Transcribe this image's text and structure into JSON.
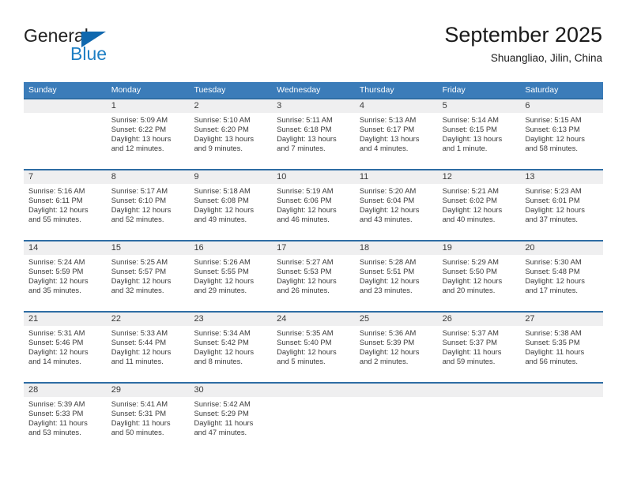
{
  "brand": {
    "name_part1": "General",
    "name_part2": "Blue",
    "accent_color": "#1068ae",
    "logo_icon": "triangle-flag-icon"
  },
  "header": {
    "title": "September 2025",
    "subtitle": "Shuangliao, Jilin, China"
  },
  "calendar": {
    "header_bg": "#3b7cb9",
    "row_border": "#2e6da4",
    "daynum_bg": "#efeff0",
    "weekdays": [
      "Sunday",
      "Monday",
      "Tuesday",
      "Wednesday",
      "Thursday",
      "Friday",
      "Saturday"
    ],
    "weeks": [
      [
        {
          "day": "",
          "sunrise": "",
          "sunset": "",
          "daylight_line1": "",
          "daylight_line2": ""
        },
        {
          "day": "1",
          "sunrise": "Sunrise: 5:09 AM",
          "sunset": "Sunset: 6:22 PM",
          "daylight_line1": "Daylight: 13 hours",
          "daylight_line2": "and 12 minutes."
        },
        {
          "day": "2",
          "sunrise": "Sunrise: 5:10 AM",
          "sunset": "Sunset: 6:20 PM",
          "daylight_line1": "Daylight: 13 hours",
          "daylight_line2": "and 9 minutes."
        },
        {
          "day": "3",
          "sunrise": "Sunrise: 5:11 AM",
          "sunset": "Sunset: 6:18 PM",
          "daylight_line1": "Daylight: 13 hours",
          "daylight_line2": "and 7 minutes."
        },
        {
          "day": "4",
          "sunrise": "Sunrise: 5:13 AM",
          "sunset": "Sunset: 6:17 PM",
          "daylight_line1": "Daylight: 13 hours",
          "daylight_line2": "and 4 minutes."
        },
        {
          "day": "5",
          "sunrise": "Sunrise: 5:14 AM",
          "sunset": "Sunset: 6:15 PM",
          "daylight_line1": "Daylight: 13 hours",
          "daylight_line2": "and 1 minute."
        },
        {
          "day": "6",
          "sunrise": "Sunrise: 5:15 AM",
          "sunset": "Sunset: 6:13 PM",
          "daylight_line1": "Daylight: 12 hours",
          "daylight_line2": "and 58 minutes."
        }
      ],
      [
        {
          "day": "7",
          "sunrise": "Sunrise: 5:16 AM",
          "sunset": "Sunset: 6:11 PM",
          "daylight_line1": "Daylight: 12 hours",
          "daylight_line2": "and 55 minutes."
        },
        {
          "day": "8",
          "sunrise": "Sunrise: 5:17 AM",
          "sunset": "Sunset: 6:10 PM",
          "daylight_line1": "Daylight: 12 hours",
          "daylight_line2": "and 52 minutes."
        },
        {
          "day": "9",
          "sunrise": "Sunrise: 5:18 AM",
          "sunset": "Sunset: 6:08 PM",
          "daylight_line1": "Daylight: 12 hours",
          "daylight_line2": "and 49 minutes."
        },
        {
          "day": "10",
          "sunrise": "Sunrise: 5:19 AM",
          "sunset": "Sunset: 6:06 PM",
          "daylight_line1": "Daylight: 12 hours",
          "daylight_line2": "and 46 minutes."
        },
        {
          "day": "11",
          "sunrise": "Sunrise: 5:20 AM",
          "sunset": "Sunset: 6:04 PM",
          "daylight_line1": "Daylight: 12 hours",
          "daylight_line2": "and 43 minutes."
        },
        {
          "day": "12",
          "sunrise": "Sunrise: 5:21 AM",
          "sunset": "Sunset: 6:02 PM",
          "daylight_line1": "Daylight: 12 hours",
          "daylight_line2": "and 40 minutes."
        },
        {
          "day": "13",
          "sunrise": "Sunrise: 5:23 AM",
          "sunset": "Sunset: 6:01 PM",
          "daylight_line1": "Daylight: 12 hours",
          "daylight_line2": "and 37 minutes."
        }
      ],
      [
        {
          "day": "14",
          "sunrise": "Sunrise: 5:24 AM",
          "sunset": "Sunset: 5:59 PM",
          "daylight_line1": "Daylight: 12 hours",
          "daylight_line2": "and 35 minutes."
        },
        {
          "day": "15",
          "sunrise": "Sunrise: 5:25 AM",
          "sunset": "Sunset: 5:57 PM",
          "daylight_line1": "Daylight: 12 hours",
          "daylight_line2": "and 32 minutes."
        },
        {
          "day": "16",
          "sunrise": "Sunrise: 5:26 AM",
          "sunset": "Sunset: 5:55 PM",
          "daylight_line1": "Daylight: 12 hours",
          "daylight_line2": "and 29 minutes."
        },
        {
          "day": "17",
          "sunrise": "Sunrise: 5:27 AM",
          "sunset": "Sunset: 5:53 PM",
          "daylight_line1": "Daylight: 12 hours",
          "daylight_line2": "and 26 minutes."
        },
        {
          "day": "18",
          "sunrise": "Sunrise: 5:28 AM",
          "sunset": "Sunset: 5:51 PM",
          "daylight_line1": "Daylight: 12 hours",
          "daylight_line2": "and 23 minutes."
        },
        {
          "day": "19",
          "sunrise": "Sunrise: 5:29 AM",
          "sunset": "Sunset: 5:50 PM",
          "daylight_line1": "Daylight: 12 hours",
          "daylight_line2": "and 20 minutes."
        },
        {
          "day": "20",
          "sunrise": "Sunrise: 5:30 AM",
          "sunset": "Sunset: 5:48 PM",
          "daylight_line1": "Daylight: 12 hours",
          "daylight_line2": "and 17 minutes."
        }
      ],
      [
        {
          "day": "21",
          "sunrise": "Sunrise: 5:31 AM",
          "sunset": "Sunset: 5:46 PM",
          "daylight_line1": "Daylight: 12 hours",
          "daylight_line2": "and 14 minutes."
        },
        {
          "day": "22",
          "sunrise": "Sunrise: 5:33 AM",
          "sunset": "Sunset: 5:44 PM",
          "daylight_line1": "Daylight: 12 hours",
          "daylight_line2": "and 11 minutes."
        },
        {
          "day": "23",
          "sunrise": "Sunrise: 5:34 AM",
          "sunset": "Sunset: 5:42 PM",
          "daylight_line1": "Daylight: 12 hours",
          "daylight_line2": "and 8 minutes."
        },
        {
          "day": "24",
          "sunrise": "Sunrise: 5:35 AM",
          "sunset": "Sunset: 5:40 PM",
          "daylight_line1": "Daylight: 12 hours",
          "daylight_line2": "and 5 minutes."
        },
        {
          "day": "25",
          "sunrise": "Sunrise: 5:36 AM",
          "sunset": "Sunset: 5:39 PM",
          "daylight_line1": "Daylight: 12 hours",
          "daylight_line2": "and 2 minutes."
        },
        {
          "day": "26",
          "sunrise": "Sunrise: 5:37 AM",
          "sunset": "Sunset: 5:37 PM",
          "daylight_line1": "Daylight: 11 hours",
          "daylight_line2": "and 59 minutes."
        },
        {
          "day": "27",
          "sunrise": "Sunrise: 5:38 AM",
          "sunset": "Sunset: 5:35 PM",
          "daylight_line1": "Daylight: 11 hours",
          "daylight_line2": "and 56 minutes."
        }
      ],
      [
        {
          "day": "28",
          "sunrise": "Sunrise: 5:39 AM",
          "sunset": "Sunset: 5:33 PM",
          "daylight_line1": "Daylight: 11 hours",
          "daylight_line2": "and 53 minutes."
        },
        {
          "day": "29",
          "sunrise": "Sunrise: 5:41 AM",
          "sunset": "Sunset: 5:31 PM",
          "daylight_line1": "Daylight: 11 hours",
          "daylight_line2": "and 50 minutes."
        },
        {
          "day": "30",
          "sunrise": "Sunrise: 5:42 AM",
          "sunset": "Sunset: 5:29 PM",
          "daylight_line1": "Daylight: 11 hours",
          "daylight_line2": "and 47 minutes."
        },
        {
          "day": "",
          "sunrise": "",
          "sunset": "",
          "daylight_line1": "",
          "daylight_line2": ""
        },
        {
          "day": "",
          "sunrise": "",
          "sunset": "",
          "daylight_line1": "",
          "daylight_line2": ""
        },
        {
          "day": "",
          "sunrise": "",
          "sunset": "",
          "daylight_line1": "",
          "daylight_line2": ""
        },
        {
          "day": "",
          "sunrise": "",
          "sunset": "",
          "daylight_line1": "",
          "daylight_line2": ""
        }
      ]
    ]
  }
}
